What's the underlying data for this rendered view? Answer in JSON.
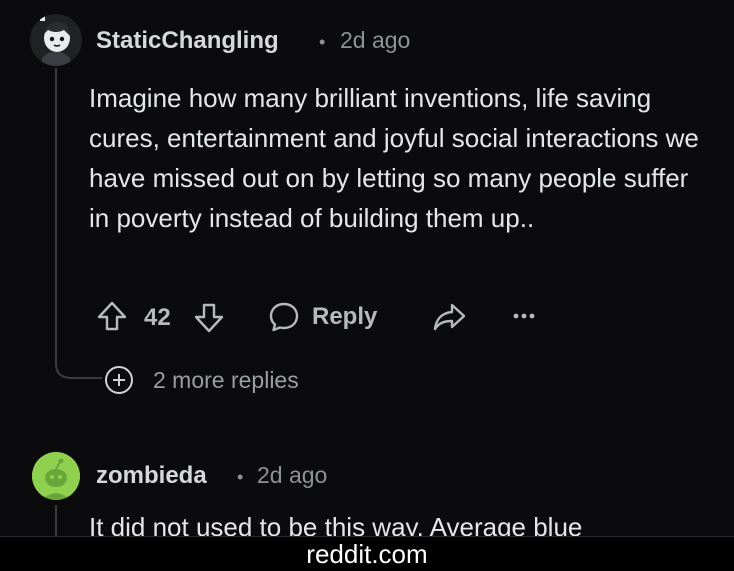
{
  "comments": [
    {
      "username": "StaticChangling",
      "separator": "•",
      "time": "2d ago",
      "body": "Imagine how many brilliant inventions, life saving cures, entertainment and joyful social interactions we have missed out on by letting so many people suffer in poverty instead of building them up..",
      "votes": "42",
      "reply_label": "Reply",
      "more_replies": "2 more replies"
    },
    {
      "username": "zombieda",
      "separator": "•",
      "time": "2d ago",
      "body_partial": "It did not used to be this way. Average blue"
    }
  ],
  "footer": {
    "domain": "reddit.com"
  },
  "icons": [
    "upvote-icon",
    "downvote-icon",
    "reply-bubble-icon",
    "share-icon",
    "more-options-icon",
    "expand-plus-icon"
  ],
  "colors": {
    "background": "#0b0b0d",
    "text": "#e4e6e9",
    "muted": "#8e9296",
    "avatar2": "#8fd14f"
  }
}
